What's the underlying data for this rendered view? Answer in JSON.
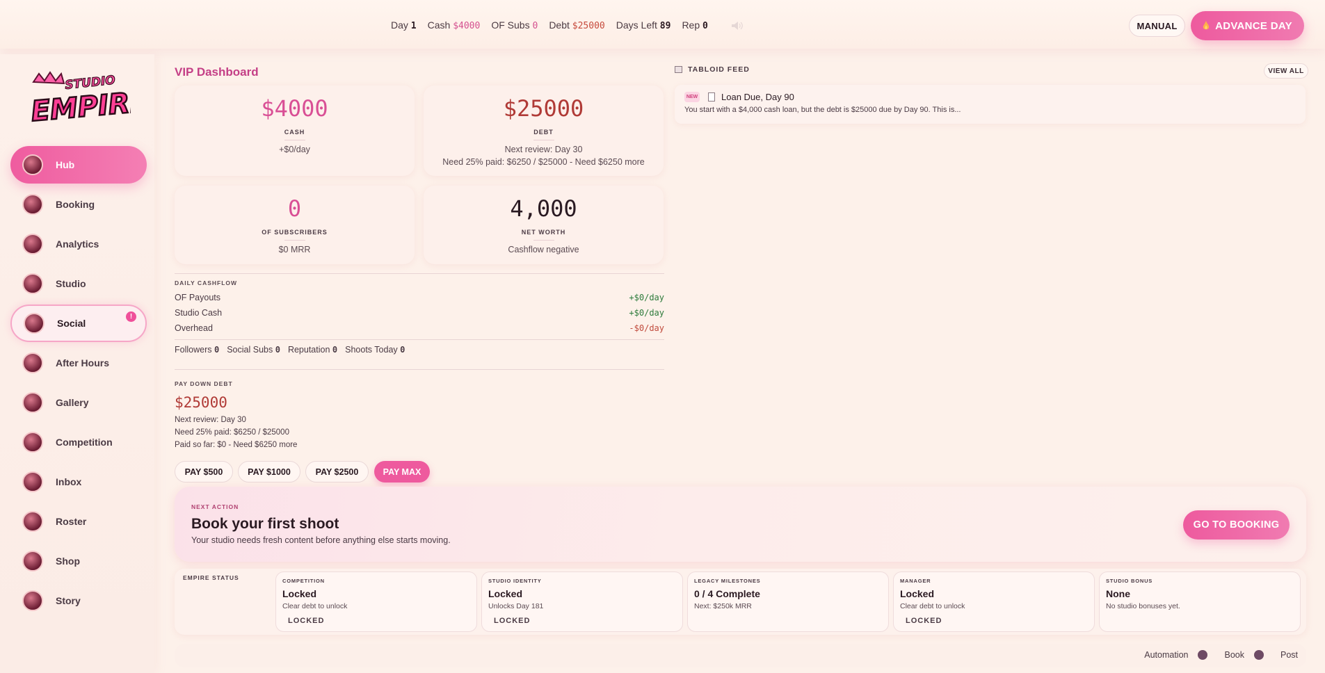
{
  "topbar": {
    "day_label": "Day",
    "day_value": "1",
    "cash_label": "Cash",
    "cash_value": "$4000",
    "subs_label": "OF Subs",
    "subs_value": "0",
    "debt_label": "Debt",
    "debt_value": "$25000",
    "days_left_label": "Days Left",
    "days_left_value": "89",
    "rep_label": "Rep",
    "rep_value": "0",
    "manual_label": "MANUAL",
    "advance_label": "ADVANCE DAY"
  },
  "sidebar": {
    "logo_text_top": "STUDIO",
    "logo_text_bottom": "EMPIRE",
    "items": [
      {
        "label": "Hub",
        "state": "active"
      },
      {
        "label": "Booking"
      },
      {
        "label": "Analytics"
      },
      {
        "label": "Studio"
      },
      {
        "label": "Social",
        "state": "outlined",
        "badge": "!"
      },
      {
        "label": "After Hours"
      },
      {
        "label": "Gallery"
      },
      {
        "label": "Competition"
      },
      {
        "label": "Inbox"
      },
      {
        "label": "Roster"
      },
      {
        "label": "Shop"
      },
      {
        "label": "Story"
      }
    ]
  },
  "dashboard": {
    "title": "VIP Dashboard",
    "cash": {
      "value": "$4000",
      "label": "CASH",
      "sub": "+$0/day"
    },
    "debt": {
      "value": "$25000",
      "label": "DEBT",
      "sub1": "Next review: Day 30",
      "sub2": "Need 25% paid: $6250 / $25000 - Need $6250 more"
    },
    "subscribers": {
      "value": "0",
      "label": "OF SUBSCRIBERS",
      "sub": "$0 MRR"
    },
    "net_worth": {
      "value": "4,000",
      "label": "NET WORTH",
      "sub": "Cashflow negative"
    },
    "daily_cashflow": {
      "label": "DAILY CASHFLOW",
      "rows": [
        {
          "name": "OF Payouts",
          "value": "+$0/day"
        },
        {
          "name": "Studio Cash",
          "value": "+$0/day"
        },
        {
          "name": "Overhead",
          "value": "-$0/day"
        }
      ]
    },
    "mini_stats": [
      {
        "label": "Followers",
        "value": "0"
      },
      {
        "label": "Social Subs",
        "value": "0"
      },
      {
        "label": "Reputation",
        "value": "0"
      },
      {
        "label": "Shoots Today",
        "value": "0"
      }
    ],
    "pay_down": {
      "label": "PAY DOWN DEBT",
      "amount": "$25000",
      "line1": "Next review: Day 30",
      "line2": "Need 25% paid: $6250 / $25000",
      "line3": "Paid so far: $0 - Need $6250 more",
      "buttons": [
        "PAY $500",
        "PAY $1000",
        "PAY $2500",
        "PAY MAX"
      ]
    }
  },
  "next_action": {
    "label": "NEXT ACTION",
    "title": "Book your first shoot",
    "sub": "Your studio needs fresh content before anything else starts moving.",
    "button": "GO TO BOOKING"
  },
  "empire_status": {
    "label": "EMPIRE STATUS",
    "cards": [
      {
        "header": "COMPETITION",
        "title": "Locked",
        "sub": "Clear debt to unlock",
        "tag": "LOCKED"
      },
      {
        "header": "STUDIO IDENTITY",
        "title": "Locked",
        "sub": "Unlocks Day 181",
        "tag": "LOCKED"
      },
      {
        "header": "LEGACY MILESTONES",
        "title": "0 / 4 Complete",
        "sub": "Next: $250k MRR",
        "tag": ""
      },
      {
        "header": "MANAGER",
        "title": "Locked",
        "sub": "Clear debt to unlock",
        "tag": "LOCKED"
      },
      {
        "header": "STUDIO BONUS",
        "title": "None",
        "sub": "No studio bonuses yet.",
        "tag": ""
      }
    ]
  },
  "automation": {
    "label": "Automation",
    "book_label": "Book",
    "post_label": "Post"
  },
  "tabloid": {
    "title": "TABLOID FEED",
    "view_all": "VIEW ALL",
    "items": [
      {
        "badge": "NEW",
        "title": "Loan Due, Day 90",
        "body": "You start with a $4,000 cash loan, but the debt is $25000 due by Day 90. This is..."
      }
    ]
  },
  "colors": {
    "accent": "#ee5a9e",
    "title": "#c43f86",
    "debt": "#b03a36",
    "positive": "#2c7a3a"
  }
}
